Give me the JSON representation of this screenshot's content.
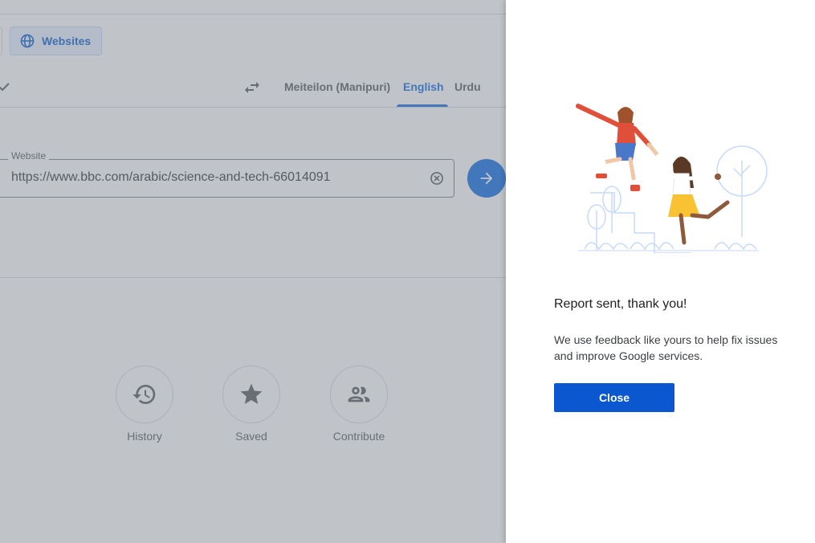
{
  "mode_tabs": {
    "websites_label": "Websites"
  },
  "languages": {
    "target": [
      "Meiteilon (Manipuri)",
      "English",
      "Urdu"
    ],
    "selected": "English"
  },
  "website_field": {
    "label": "Website",
    "value": "https://www.bbc.com/arabic/science-and-tech-66014091"
  },
  "quick_actions": [
    {
      "label": "History",
      "icon": "history-icon"
    },
    {
      "label": "Saved",
      "icon": "star-icon"
    },
    {
      "label": "Contribute",
      "icon": "people-icon"
    }
  ],
  "feedback_panel": {
    "title": "Report sent, thank you!",
    "body": "We use feedback like yours to help fix issues and improve Google services.",
    "close_label": "Close"
  },
  "colors": {
    "accent": "#1a73e8",
    "close_button": "#0b57d0",
    "scrim": "rgba(115,125,135,0.45)"
  }
}
